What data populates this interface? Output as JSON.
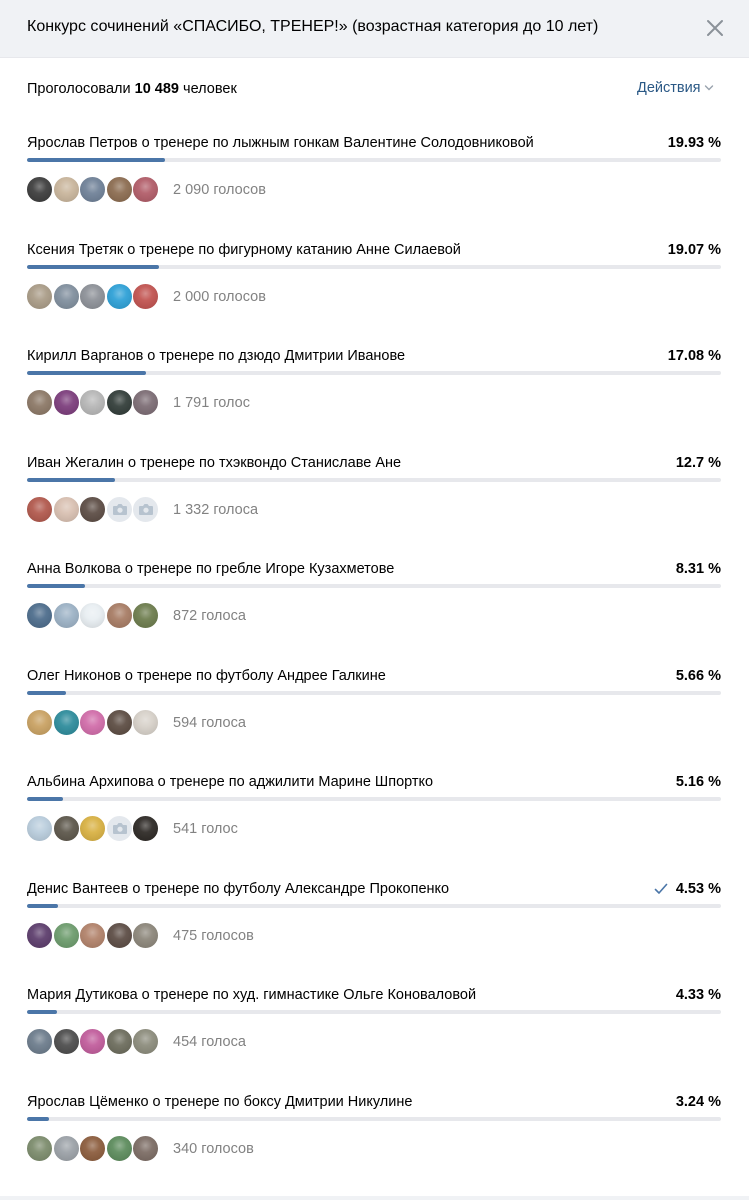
{
  "header": {
    "title": "Конкурс сочинений «СПАСИБО, ТРЕНЕР!» (возрастная категория до 10 лет)",
    "close_icon": "close-icon"
  },
  "summary": {
    "prefix": "Проголосовали",
    "count": "10 489",
    "suffix": "человек"
  },
  "actions": {
    "label": "Действия",
    "icon": "chevron-down-icon"
  },
  "colors": {
    "accent": "#4b76a8",
    "link": "#2a5885",
    "track": "#e7e8ec",
    "muted": "#828282"
  },
  "options": [
    {
      "text": "Ярослав Петров о тренере по лыжным гонкам Валентине Солодовниковой",
      "percent_label": "19.93 %",
      "percent": 19.93,
      "votes": "2 090 голосов",
      "voted": false,
      "avatars": [
        "#3a3a3a",
        "#c8b49a",
        "#6d7f96",
        "#8a6a4e",
        "#b05a66"
      ]
    },
    {
      "text": "Ксения Третяк о тренере по фигурному катанию Анне Силаевой",
      "percent_label": "19.07 %",
      "percent": 19.07,
      "votes": "2 000 голосов",
      "voted": false,
      "avatars": [
        "#a89a85",
        "#7e8d9c",
        "#8b8f96",
        "#2a9fd6",
        "#c0504d"
      ]
    },
    {
      "text": "Кирилл Варганов о тренере по дзюдо Дмитрии Иванове",
      "percent_label": "17.08 %",
      "percent": 17.08,
      "votes": "1 791 голос",
      "voted": false,
      "avatars": [
        "#8a7664",
        "#7a3a7a",
        "#b5b5b5",
        "#2f3a36",
        "#7a6a72"
      ]
    },
    {
      "text": "Иван Жегалин о тренере по тхэквондо Станиславе Ане",
      "percent_label": "12.7 %",
      "percent": 12.7,
      "votes": "1 332 голоса",
      "voted": false,
      "avatars": [
        "#b0564a",
        "#d8bfb0",
        "#5a4a42",
        "camera",
        "camera"
      ]
    },
    {
      "text": "Анна Волкова о тренере по гребле Игоре Кузахметове",
      "percent_label": "8.31 %",
      "percent": 8.31,
      "votes": "872 голоса",
      "voted": false,
      "avatars": [
        "#4a6a8a",
        "#9ab0c4",
        "#e8eef2",
        "#a67a62",
        "#6a7a4a"
      ]
    },
    {
      "text": "Олег Никонов о тренере по футболу Андрее Галкине",
      "percent_label": "5.66 %",
      "percent": 5.66,
      "votes": "594 голоса",
      "voted": false,
      "avatars": [
        "#c8a060",
        "#2a8a9a",
        "#d06aa8",
        "#5a4a40",
        "#d6d0c8"
      ]
    },
    {
      "text": "Альбина Архипова о тренере по аджилити Марине Шпортко",
      "percent_label": "5.16 %",
      "percent": 5.16,
      "votes": "541 голос",
      "voted": false,
      "avatars": [
        "#b8ccdc",
        "#5a5448",
        "#d8b040",
        "camera",
        "#2a2622"
      ]
    },
    {
      "text": "Денис Вантеев о тренере по футболу Александре Прокопенко",
      "percent_label": "4.53 %",
      "percent": 4.53,
      "votes": "475 голосов",
      "voted": true,
      "avatars": [
        "#5a3a6a",
        "#6a9a6a",
        "#b08068",
        "#5a4a42",
        "#8a8478"
      ]
    },
    {
      "text": "Мария Дутикова о тренере по худ. гимнастике Ольге Коноваловой",
      "percent_label": "4.33 %",
      "percent": 4.33,
      "votes": "454 голоса",
      "voted": false,
      "avatars": [
        "#6a7a8a",
        "#4a4a4a",
        "#c05a9a",
        "#6a6a5a",
        "#8a8a7a"
      ]
    },
    {
      "text": "Ярослав Цёменко о тренере по боксу Дмитрии Никулине",
      "percent_label": "3.24 %",
      "percent": 3.24,
      "votes": "340 голосов",
      "voted": false,
      "avatars": [
        "#7a8a6a",
        "#9aa0a6",
        "#8a5a3a",
        "#5a8a5a",
        "#7a6a62"
      ]
    }
  ]
}
